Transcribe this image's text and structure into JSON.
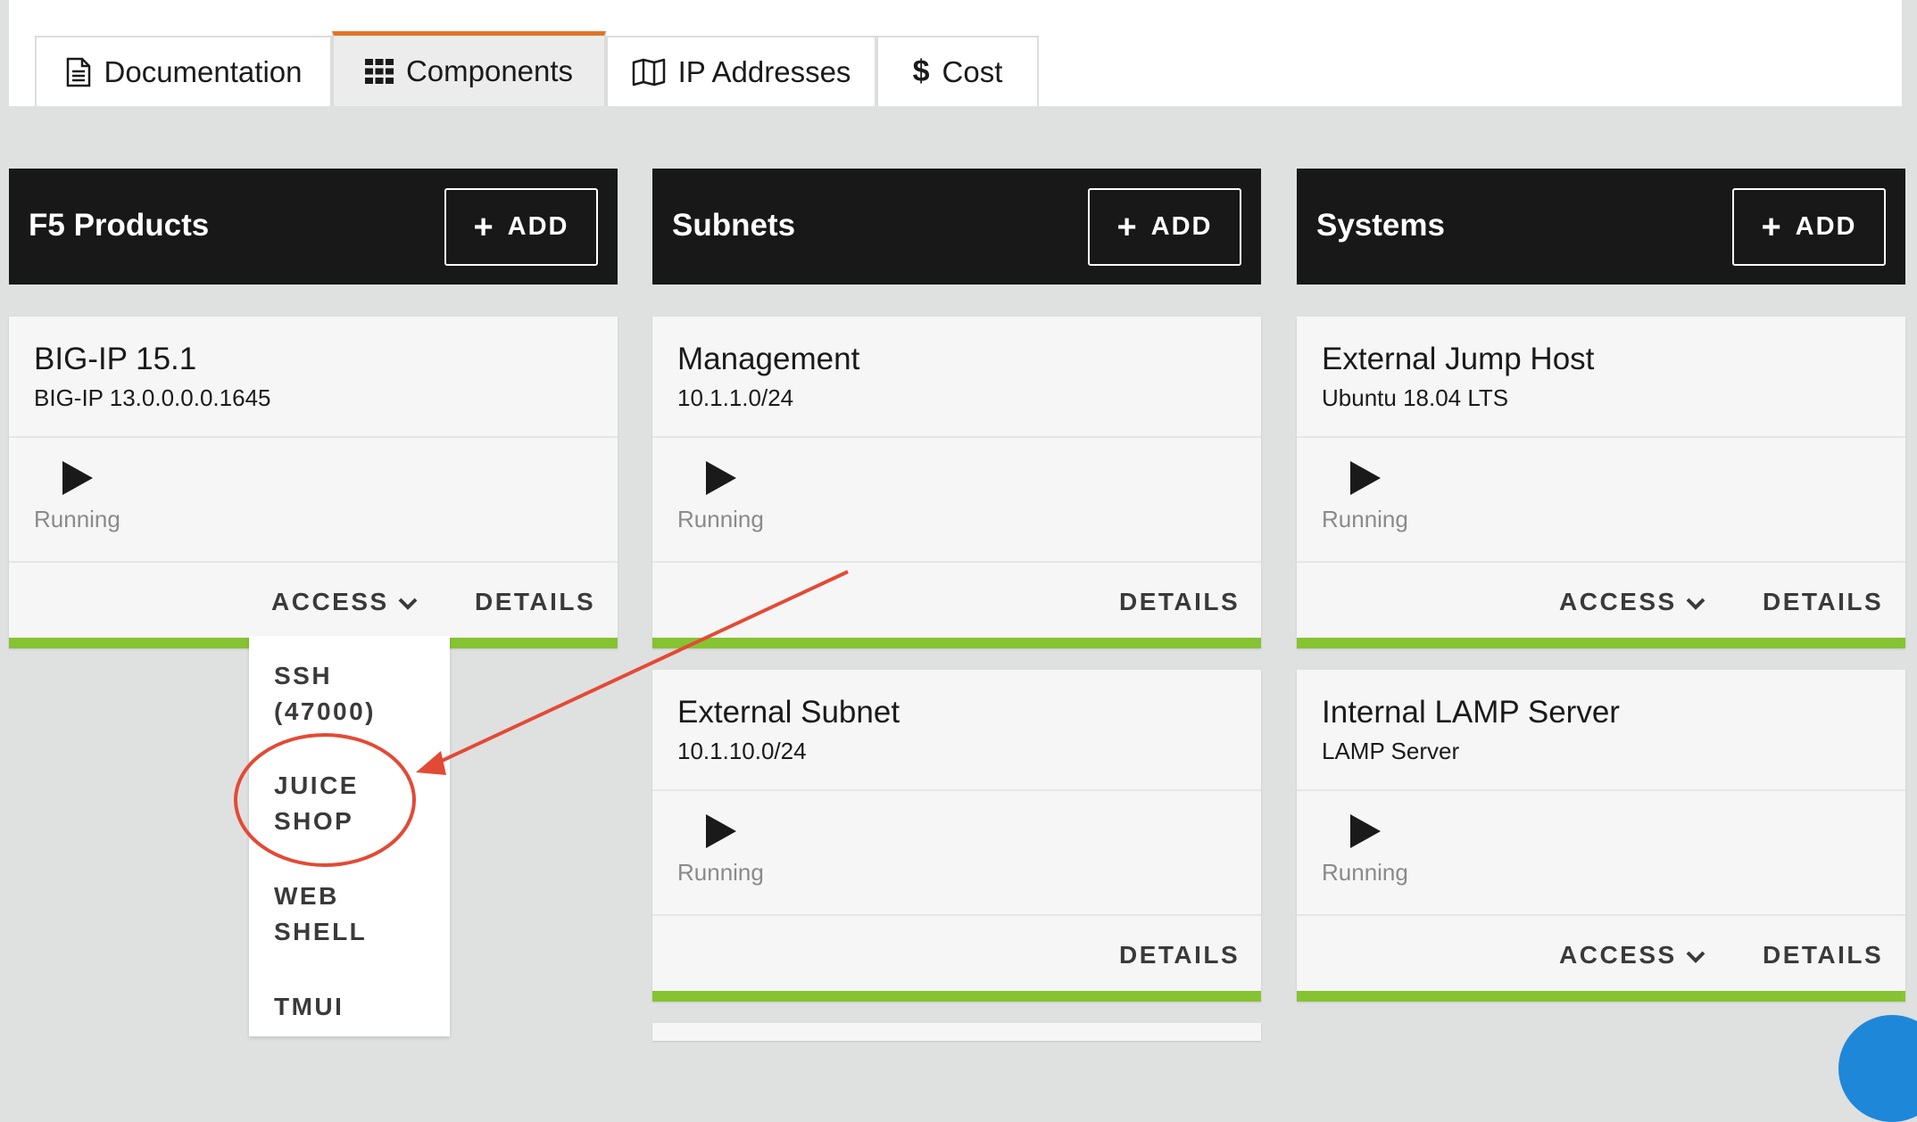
{
  "tabs": [
    {
      "label": "Documentation",
      "icon": "document-icon",
      "active": false
    },
    {
      "label": "Components",
      "icon": "grid-icon",
      "active": true
    },
    {
      "label": "IP Addresses",
      "icon": "map-icon",
      "active": false
    },
    {
      "label": "Cost",
      "icon": "dollar-icon",
      "active": false
    }
  ],
  "colors": {
    "accent_tab": "#e07524",
    "status_green": "#86c332",
    "header_bg": "#181818",
    "annotation_red": "#e34a35"
  },
  "add_label": "ADD",
  "columns": [
    {
      "title": "F5 Products",
      "cards": [
        {
          "title": "BIG-IP 15.1",
          "subtitle": "BIG-IP 13.0.0.0.0.1645",
          "status": "Running",
          "access": "ACCESS",
          "details": "DETAILS"
        }
      ]
    },
    {
      "title": "Subnets",
      "cards": [
        {
          "title": "Management",
          "subtitle": "10.1.1.0/24",
          "status": "Running",
          "details": "DETAILS"
        },
        {
          "title": "External Subnet",
          "subtitle": "10.1.10.0/24",
          "status": "Running",
          "details": "DETAILS"
        }
      ]
    },
    {
      "title": "Systems",
      "cards": [
        {
          "title": "External Jump Host",
          "subtitle": "Ubuntu 18.04 LTS",
          "status": "Running",
          "access": "ACCESS",
          "details": "DETAILS"
        },
        {
          "title": "Internal LAMP Server",
          "subtitle": "LAMP Server",
          "status": "Running",
          "access": "ACCESS",
          "details": "DETAILS"
        }
      ]
    }
  ],
  "access_dropdown": {
    "items": [
      {
        "line1": "SSH",
        "line2": "(47000)"
      },
      {
        "line1": "JUICE",
        "line2": "SHOP",
        "highlighted": true
      },
      {
        "line1": "WEB",
        "line2": "SHELL"
      },
      {
        "line1": "TMUI",
        "line2": ""
      }
    ]
  }
}
